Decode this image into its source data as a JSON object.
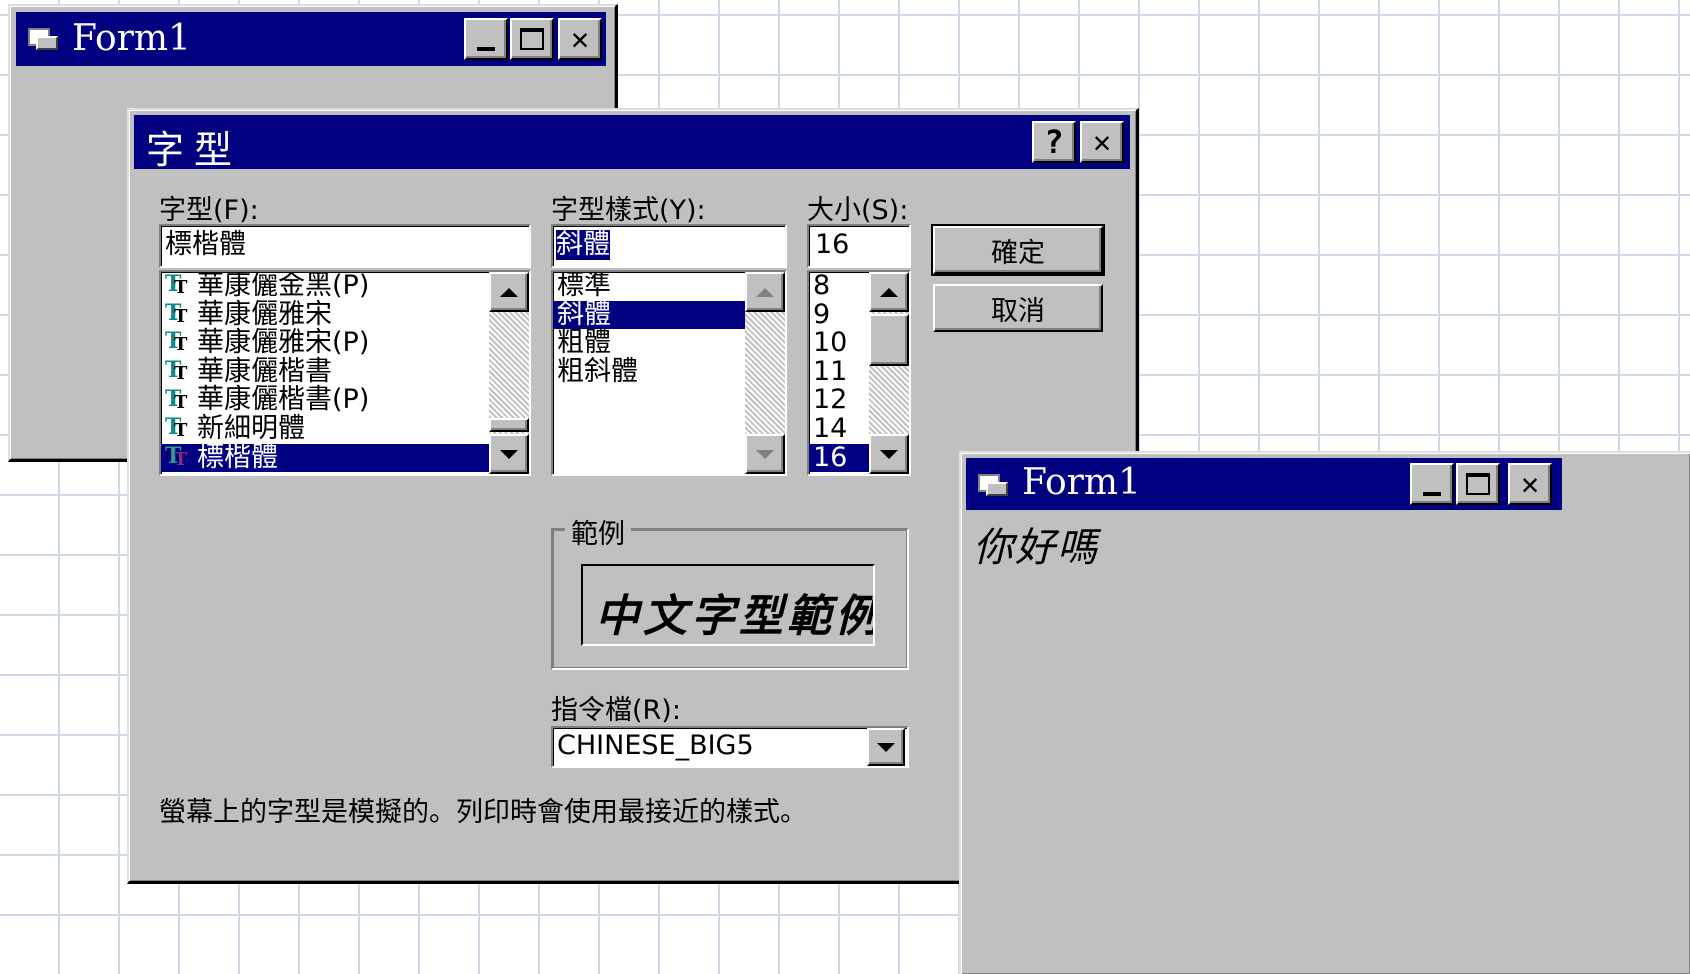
{
  "colors": {
    "titlebar": "#000080",
    "face": "#c0c0c0",
    "selection": "#000080"
  },
  "form_back": {
    "title": "Form1",
    "icon": "form-icon",
    "buttons": [
      "minimize-icon",
      "maximize-icon",
      "close-icon"
    ]
  },
  "font_dialog": {
    "title": "字型",
    "help_label": "?",
    "close_label": "✕",
    "font_label": "字型(F):",
    "font_value": "標楷體",
    "font_list": [
      "華康儷金黑(P)",
      "華康儷雅宋",
      "華康儷雅宋(P)",
      "華康儷楷書",
      "華康儷楷書(P)",
      "新細明體",
      "標楷體"
    ],
    "font_selected_index": 6,
    "style_label": "字型樣式(Y):",
    "style_value": "斜體",
    "style_list": [
      "標準",
      "斜體",
      "粗體",
      "粗斜體"
    ],
    "style_selected_index": 1,
    "size_label": "大小(S):",
    "size_value": "16",
    "size_list": [
      "8",
      "9",
      "10",
      "11",
      "12",
      "14",
      "16"
    ],
    "size_selected_index": 6,
    "ok_label": "確定",
    "cancel_label": "取消",
    "sample_label": "範例",
    "sample_text": "中文字型範例",
    "script_label": "指令檔(R):",
    "script_value": "CHINESE_BIG5",
    "note": "螢幕上的字型是模擬的。列印時會使用最接近的樣式。"
  },
  "form_front": {
    "title": "Form1",
    "icon": "form-icon",
    "content_text": "你好嗎"
  }
}
